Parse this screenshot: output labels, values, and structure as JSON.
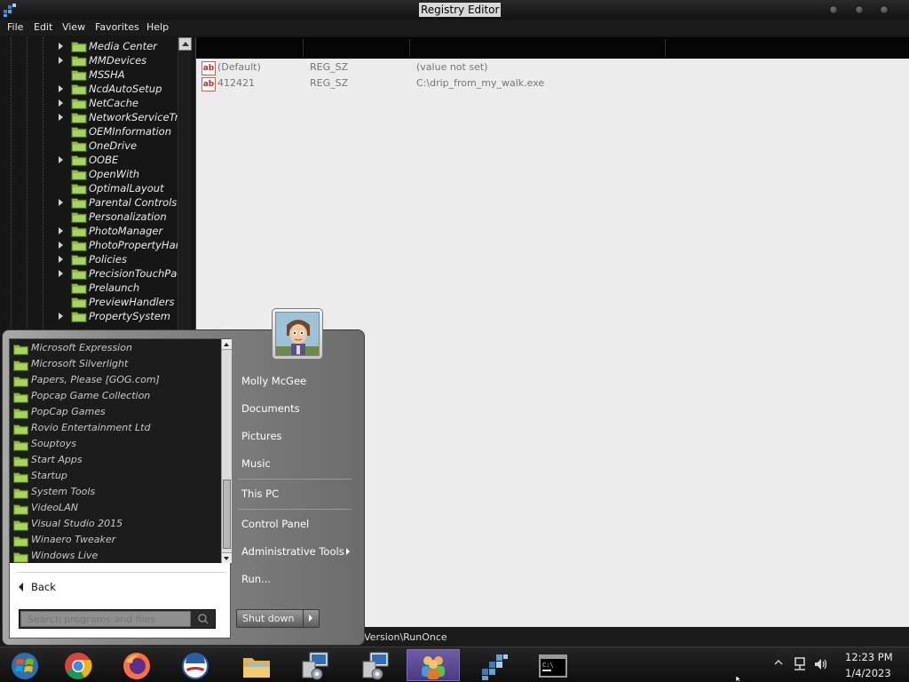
{
  "window": {
    "title": "Registry Editor",
    "menu": [
      "File",
      "Edit",
      "View",
      "Favorites",
      "Help"
    ]
  },
  "tree": {
    "items": [
      {
        "label": "Media Center",
        "expandable": true
      },
      {
        "label": "MMDevices",
        "expandable": true
      },
      {
        "label": "MSSHA",
        "expandable": false
      },
      {
        "label": "NcdAutoSetup",
        "expandable": true
      },
      {
        "label": "NetCache",
        "expandable": true
      },
      {
        "label": "NetworkServiceTrig",
        "expandable": true
      },
      {
        "label": "OEMInformation",
        "expandable": false
      },
      {
        "label": "OneDrive",
        "expandable": false
      },
      {
        "label": "OOBE",
        "expandable": true
      },
      {
        "label": "OpenWith",
        "expandable": false
      },
      {
        "label": "OptimalLayout",
        "expandable": false
      },
      {
        "label": "Parental Controls",
        "expandable": true
      },
      {
        "label": "Personalization",
        "expandable": false
      },
      {
        "label": "PhotoManager",
        "expandable": true
      },
      {
        "label": "PhotoPropertyHand",
        "expandable": true
      },
      {
        "label": "Policies",
        "expandable": true
      },
      {
        "label": "PrecisionTouchPad",
        "expandable": true
      },
      {
        "label": "Prelaunch",
        "expandable": false
      },
      {
        "label": "PreviewHandlers",
        "expandable": false
      },
      {
        "label": "PropertySystem",
        "expandable": true
      }
    ]
  },
  "values": {
    "rows": [
      {
        "name": "(Default)",
        "type": "REG_SZ",
        "data": "(value not set)"
      },
      {
        "name": "412421",
        "type": "REG_SZ",
        "data": "C:\\drip_from_my_walk.exe"
      }
    ]
  },
  "status": {
    "text": "Version\\RunOnce"
  },
  "start_menu": {
    "programs": [
      "Microsoft Expression",
      "Microsoft Silverlight",
      "Papers, Please [GOG.com]",
      "Popcap Game Collection",
      "PopCap Games",
      "Rovio Entertainment Ltd",
      "Souptoys",
      "Start Apps",
      "Startup",
      "System Tools",
      "VideoLAN",
      "Visual Studio 2015",
      "Winaero Tweaker",
      "Windows Live"
    ],
    "back_label": "Back",
    "search_placeholder": "Search programs and files",
    "user_name": "Molly McGee",
    "right_items": [
      "Documents",
      "Pictures",
      "Music",
      "This PC",
      "Control Panel",
      "Administrative Tools",
      "Run..."
    ],
    "shutdown_label": "Shut down"
  },
  "taskbar": {
    "apps": [
      "start-orb",
      "chrome",
      "firefox",
      "obama-app",
      "file-explorer",
      "network-settings",
      "network-settings-2",
      "users-app",
      "registry-editor",
      "command-prompt"
    ],
    "time": "12:23 PM",
    "date": "1/4/2023"
  },
  "colors": {
    "window_bg": "#161616",
    "values_bg": "#ececec",
    "folder": "#8cbd3d",
    "taskbar_active": "#5b4a94"
  }
}
